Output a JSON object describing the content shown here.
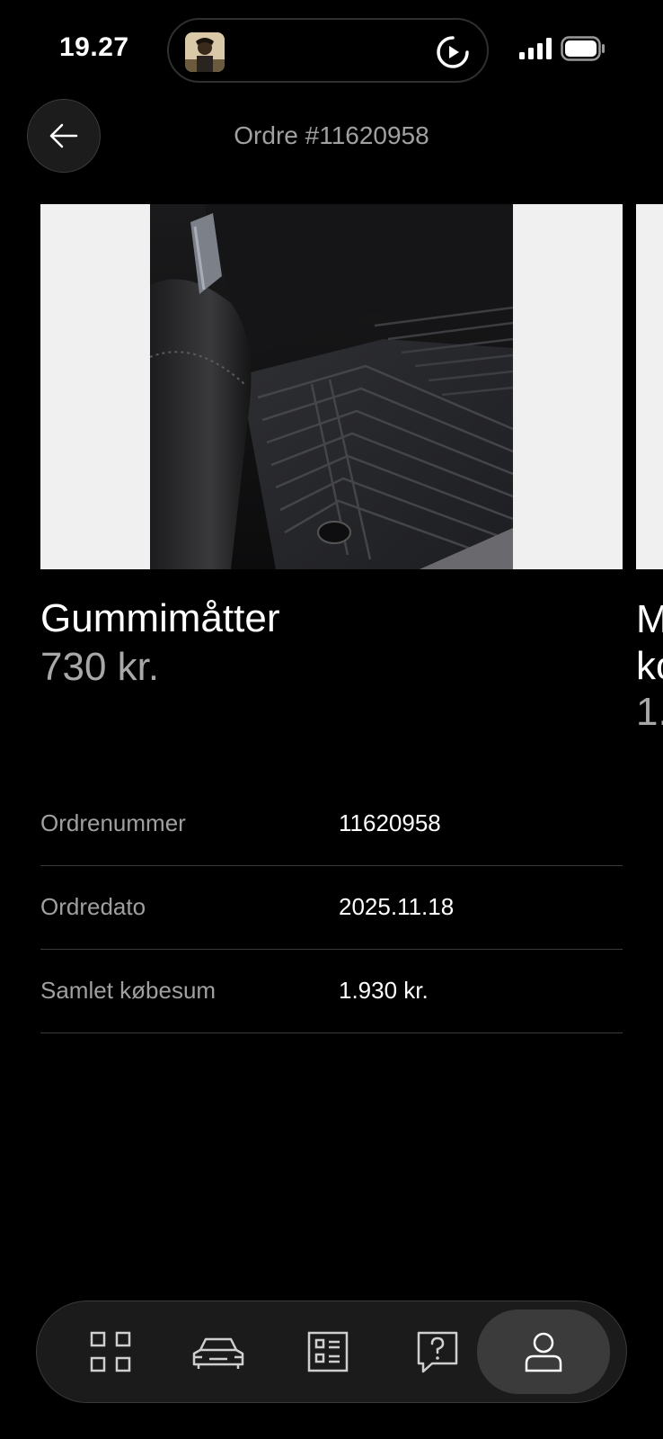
{
  "status_bar": {
    "time": "19.27"
  },
  "header": {
    "title": "Ordre #11620958"
  },
  "products": [
    {
      "name": "Gummimåtter",
      "price": "730 kr."
    },
    {
      "name_line1": "M",
      "name_line2": "ko",
      "price": "1.2"
    }
  ],
  "details": [
    {
      "label": "Ordrenummer",
      "value": "11620958"
    },
    {
      "label": "Ordredato",
      "value": "2025.11.18"
    },
    {
      "label": "Samlet købesum",
      "value": "1.930 kr."
    }
  ],
  "nav": {
    "items": [
      {
        "icon": "grid-icon"
      },
      {
        "icon": "car-icon"
      },
      {
        "icon": "list-icon"
      },
      {
        "icon": "help-icon"
      },
      {
        "icon": "profile-icon",
        "active": true
      }
    ]
  }
}
